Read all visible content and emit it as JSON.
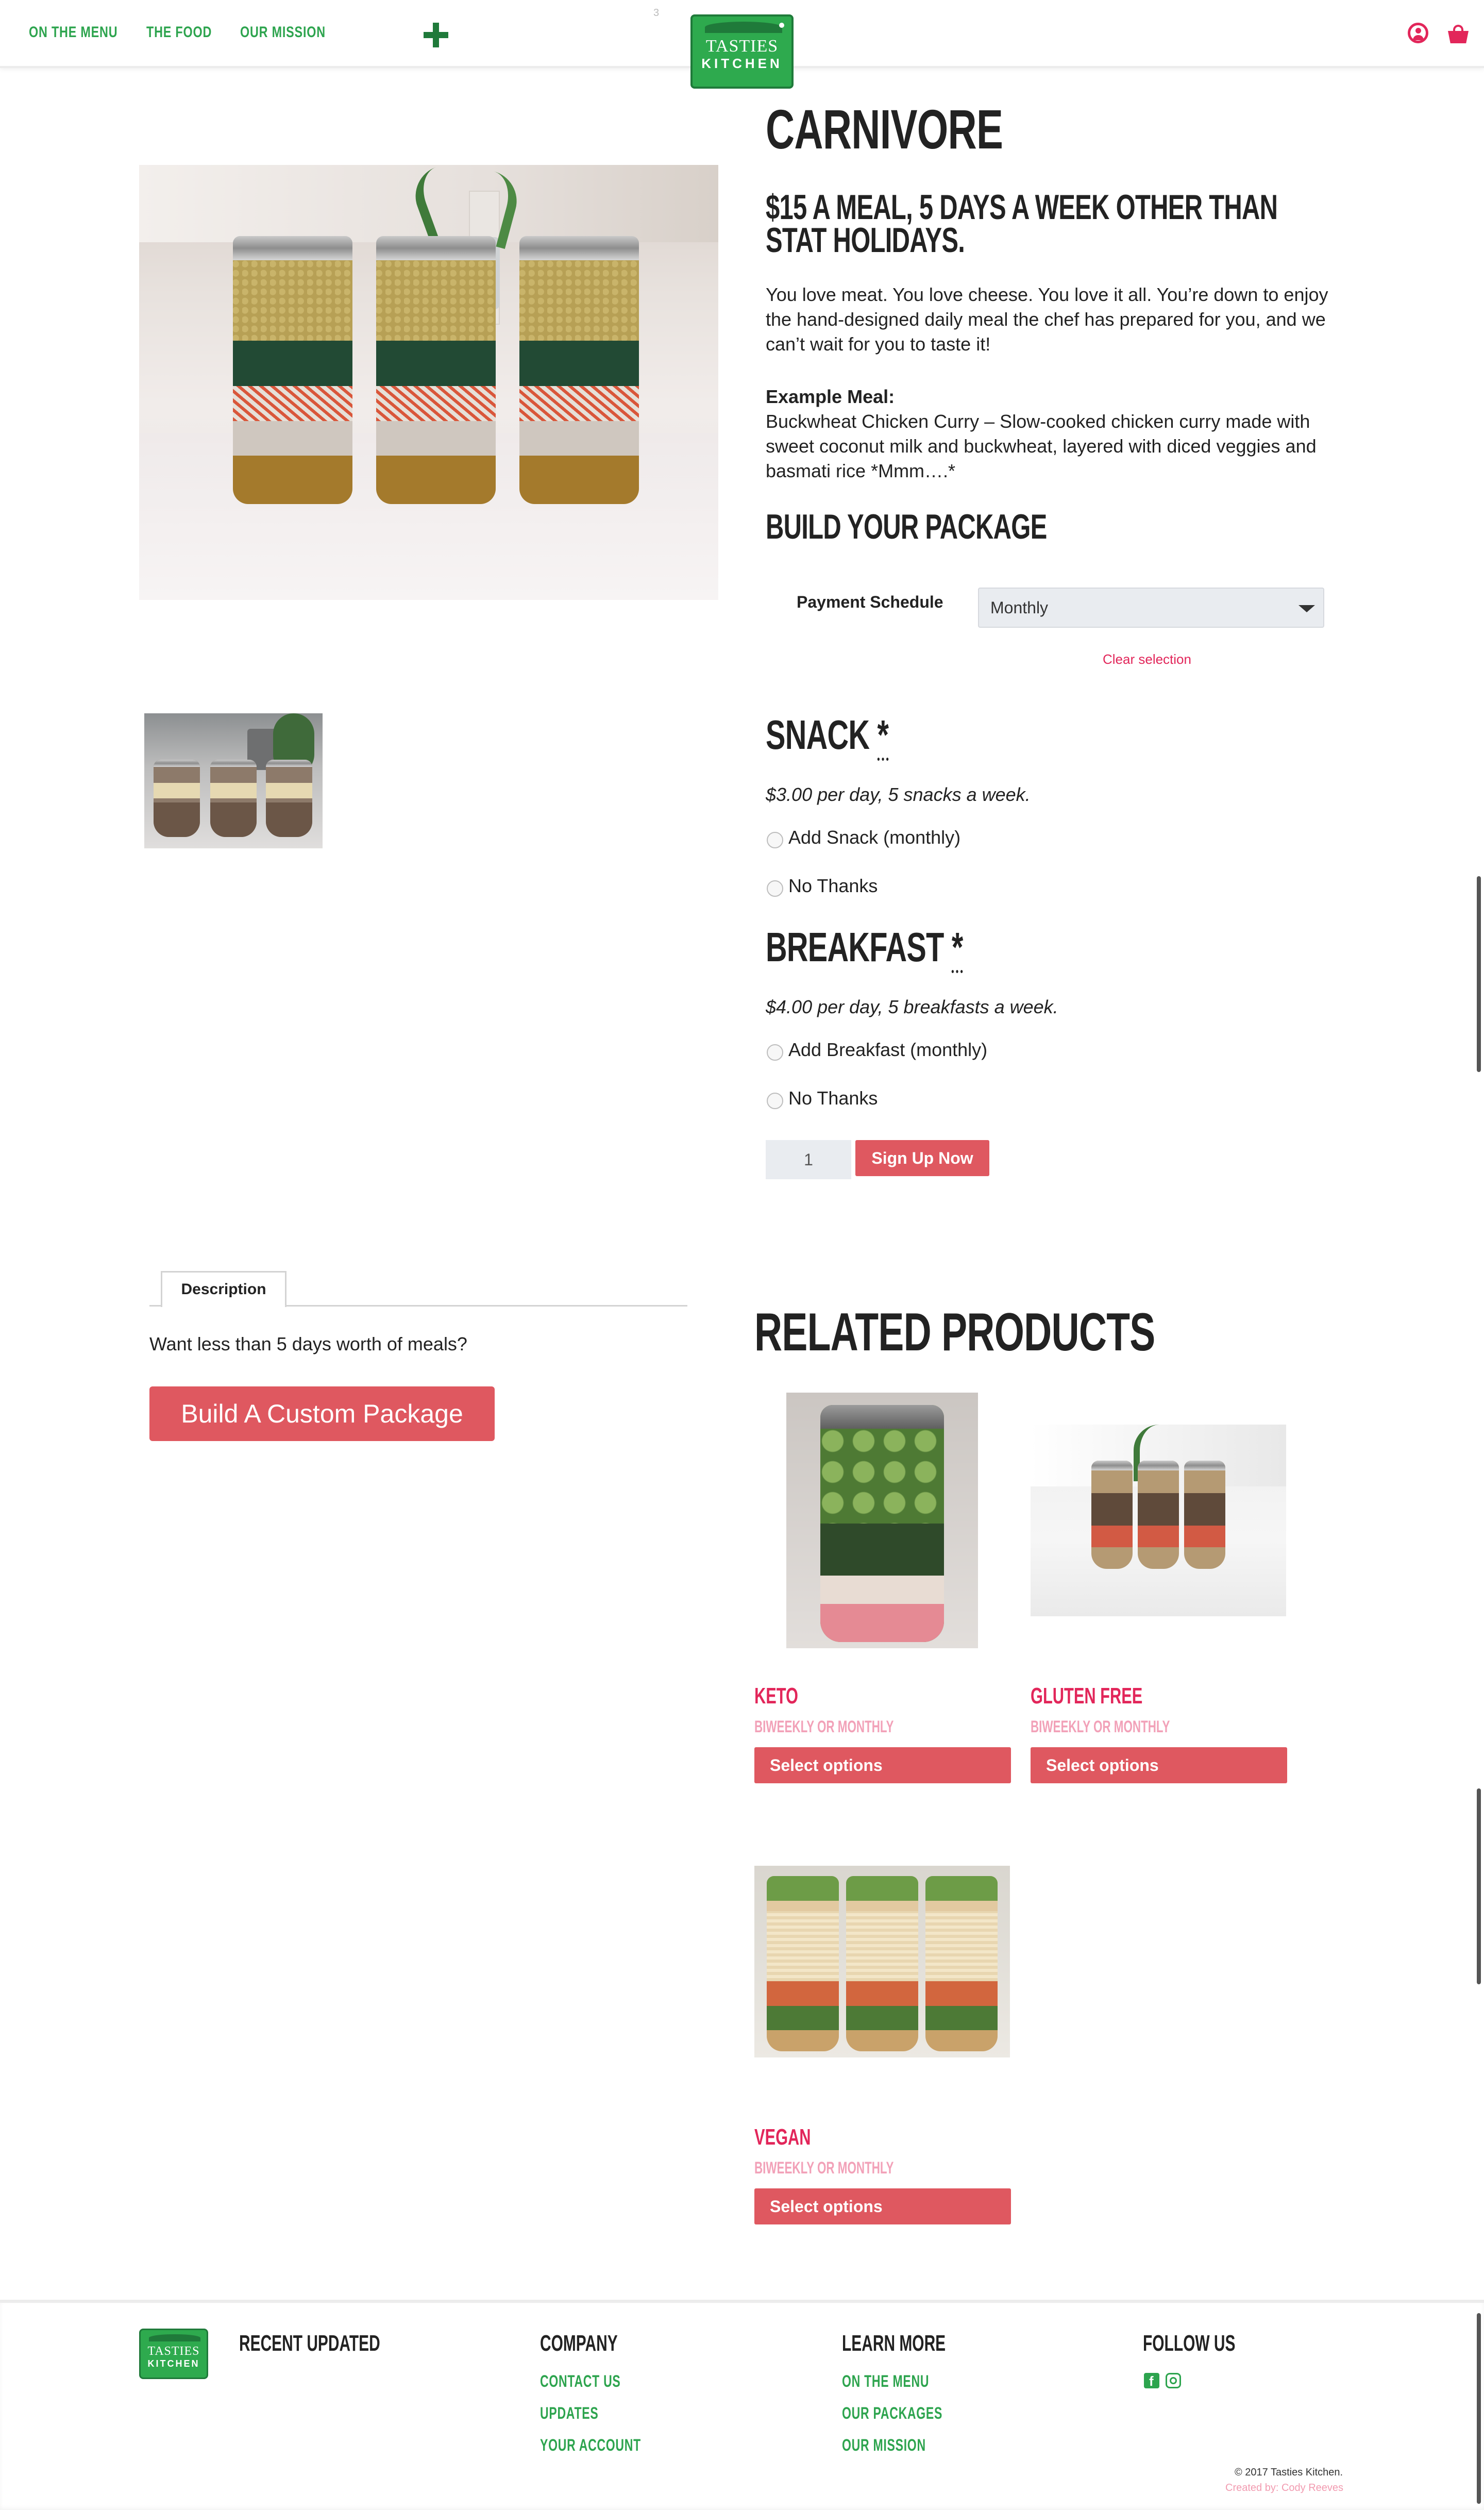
{
  "header": {
    "nav": [
      "ON THE MENU",
      "THE FOOD",
      "OUR MISSION"
    ],
    "logo_line1": "TASTIES",
    "logo_line2": "KITCHEN",
    "small_mark": "3"
  },
  "product": {
    "title": "CARNIVORE",
    "price_line": "$15 A MEAL, 5 DAYS A WEEK OTHER THAN STAT HOLIDAYS.",
    "description": "You love meat. You love cheese. You love it all. You’re down to enjoy the hand-designed daily meal the chef has prepared for you, and we can’t wait for you to taste it!",
    "example_label": "Example Meal:",
    "example_text": "Buckwheat Chicken Curry – Slow-cooked chicken curry made with sweet coconut milk and buckwheat, layered with diced veggies and basmati rice *Mmm….*"
  },
  "package": {
    "heading": "BUILD YOUR PACKAGE",
    "payment_label": "Payment Schedule",
    "payment_value": "Monthly",
    "clear": "Clear selection"
  },
  "snack": {
    "heading": "SNACK",
    "required": "*",
    "note": "$3.00 per day, 5 snacks a week.",
    "options": [
      "Add Snack (monthly)",
      "No Thanks"
    ]
  },
  "breakfast": {
    "heading": "BREAKFAST",
    "required": "*",
    "note": "$4.00 per day, 5 breakfasts a week.",
    "options": [
      "Add Breakfast (monthly)",
      "No Thanks"
    ]
  },
  "cart": {
    "quantity": "1",
    "signup": "Sign Up Now"
  },
  "tabs": {
    "description_tab": "Description",
    "text": "Want less than 5 days worth of meals?",
    "custom_button": "Build A Custom Package"
  },
  "related": {
    "heading": "RELATED PRODUCTS",
    "items": [
      {
        "name": "KETO",
        "sub": "BIWEEKLY OR MONTHLY",
        "button": "Select options"
      },
      {
        "name": "GLUTEN FREE",
        "sub": "BIWEEKLY OR MONTHLY",
        "button": "Select options"
      },
      {
        "name": "VEGAN",
        "sub": "BIWEEKLY OR MONTHLY",
        "button": "Select options"
      }
    ]
  },
  "footer": {
    "col1": "RECENT UPDATED",
    "col2": {
      "title": "COMPANY",
      "links": [
        "CONTACT US",
        "UPDATES",
        "YOUR ACCOUNT"
      ]
    },
    "col3": {
      "title": "LEARN MORE",
      "links": [
        "ON THE MENU",
        "OUR PACKAGES",
        "OUR MISSION"
      ]
    },
    "col4": {
      "title": "FOLLOW US"
    },
    "copyright": "© 2017 Tasties Kitchen.",
    "credit": "Created by: Cody Reeves"
  },
  "colors": {
    "green": "#2da44e",
    "dark_green": "#1f7a3a",
    "pink": "#e2265a",
    "button_red": "#df5860"
  }
}
